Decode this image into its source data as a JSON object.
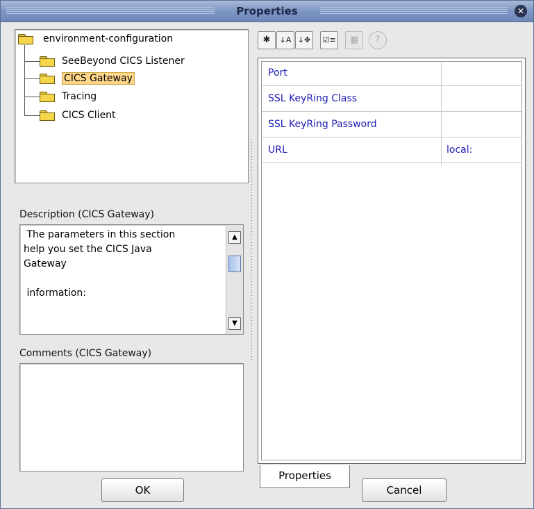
{
  "window": {
    "title": "Properties"
  },
  "tree": {
    "root": {
      "label": "environment-configuration",
      "icon": "folder-icon"
    },
    "items": [
      {
        "label": "SeeBeyond CICS Listener",
        "icon": "folder-icon",
        "selected": false
      },
      {
        "label": "CICS Gateway",
        "icon": "folder-icon",
        "selected": true
      },
      {
        "label": "Tracing",
        "icon": "folder-icon",
        "selected": false
      },
      {
        "label": "CICS Client",
        "icon": "folder-icon",
        "selected": false
      }
    ]
  },
  "description": {
    "label": "Description (CICS Gateway)",
    "text_lines": [
      " The parameters in this section",
      "help you set the CICS Java",
      "Gateway",
      "",
      " information:"
    ]
  },
  "comments": {
    "label": "Comments (CICS Gateway)",
    "value": ""
  },
  "toolbar": {
    "buttons": [
      {
        "name": "expand-icon",
        "glyph": "✱",
        "enabled": true
      },
      {
        "name": "sort-alpha-icon",
        "glyph": "↓A",
        "enabled": true
      },
      {
        "name": "sort-category-icon",
        "glyph": "↓✥",
        "enabled": true
      },
      {
        "name": "checklist-icon",
        "glyph": "☑≡",
        "enabled": true
      },
      {
        "name": "grid-icon",
        "glyph": "▦",
        "enabled": false
      },
      {
        "name": "help-icon",
        "glyph": "?",
        "enabled": false
      }
    ]
  },
  "properties": [
    {
      "name": "Port",
      "value": ""
    },
    {
      "name": "SSL KeyRing Class",
      "value": ""
    },
    {
      "name": "SSL KeyRing Password",
      "value": ""
    },
    {
      "name": "URL",
      "value": "local:"
    }
  ],
  "tabs": {
    "properties": "Properties"
  },
  "buttons": {
    "ok": "OK",
    "cancel": "Cancel"
  },
  "colors": {
    "titlebar": "#7f97c4",
    "selection": "#ffd68a",
    "property_text": "#1b1bb4"
  }
}
